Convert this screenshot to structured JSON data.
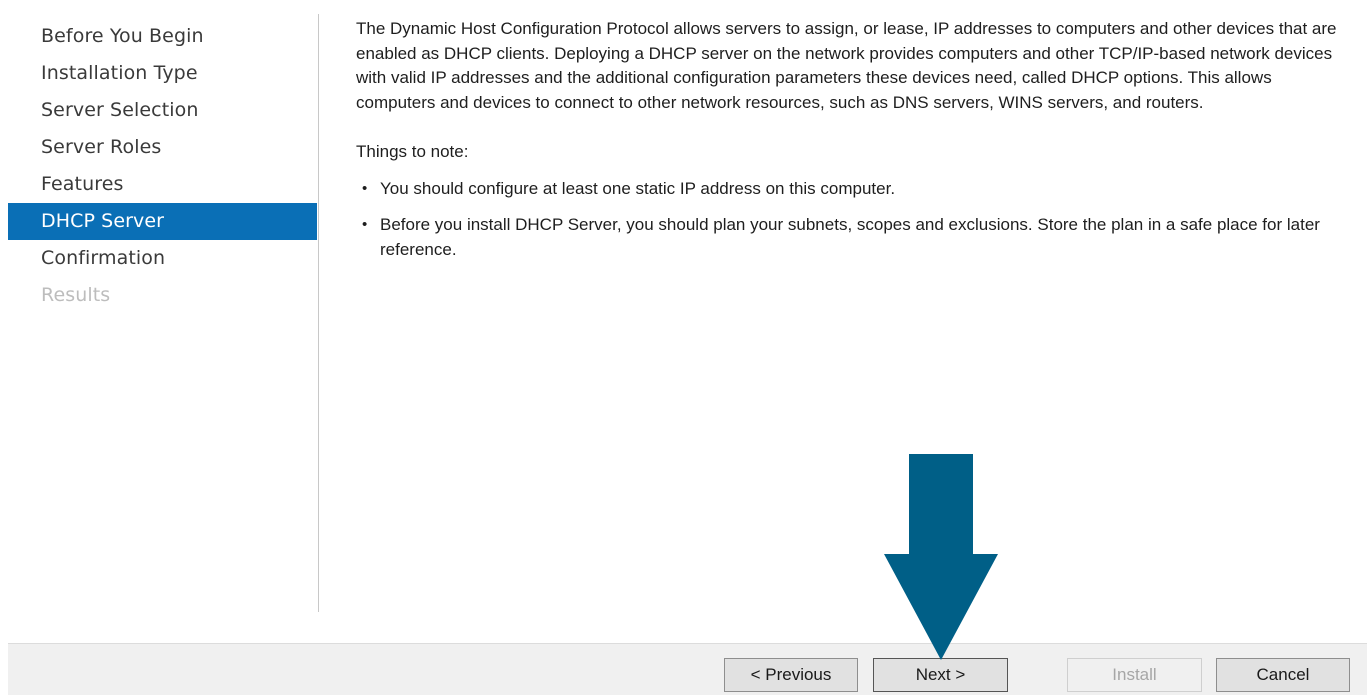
{
  "nav": {
    "items": [
      {
        "label": "Before You Begin",
        "state": "normal"
      },
      {
        "label": "Installation Type",
        "state": "normal"
      },
      {
        "label": "Server Selection",
        "state": "normal"
      },
      {
        "label": "Server Roles",
        "state": "normal"
      },
      {
        "label": "Features",
        "state": "normal"
      },
      {
        "label": "DHCP Server",
        "state": "active"
      },
      {
        "label": "Confirmation",
        "state": "normal"
      },
      {
        "label": "Results",
        "state": "disabled"
      }
    ]
  },
  "content": {
    "intro": "The Dynamic Host Configuration Protocol allows servers to assign, or lease, IP addresses to computers and other devices that are enabled as DHCP clients. Deploying a DHCP server on the network provides computers and other TCP/IP-based network devices with valid IP addresses and the additional configuration parameters these devices need, called DHCP options. This allows computers and devices to connect to other network resources, such as DNS servers, WINS servers, and routers.",
    "notes_heading": "Things to note:",
    "bullet_glyph": "•",
    "notes": [
      "You should configure at least one static IP address on this computer.",
      "Before you install DHCP Server, you should plan your subnets, scopes and exclusions. Store the plan in a safe place for later reference."
    ]
  },
  "annotation": {
    "icon": "down-arrow-icon",
    "color": "#005f87"
  },
  "footer": {
    "previous_label": "< Previous",
    "next_label": "Next >",
    "install_label": "Install",
    "cancel_label": "Cancel"
  },
  "colors": {
    "accent": "#0a6fb6",
    "disabled_text": "#bdbdbd"
  }
}
